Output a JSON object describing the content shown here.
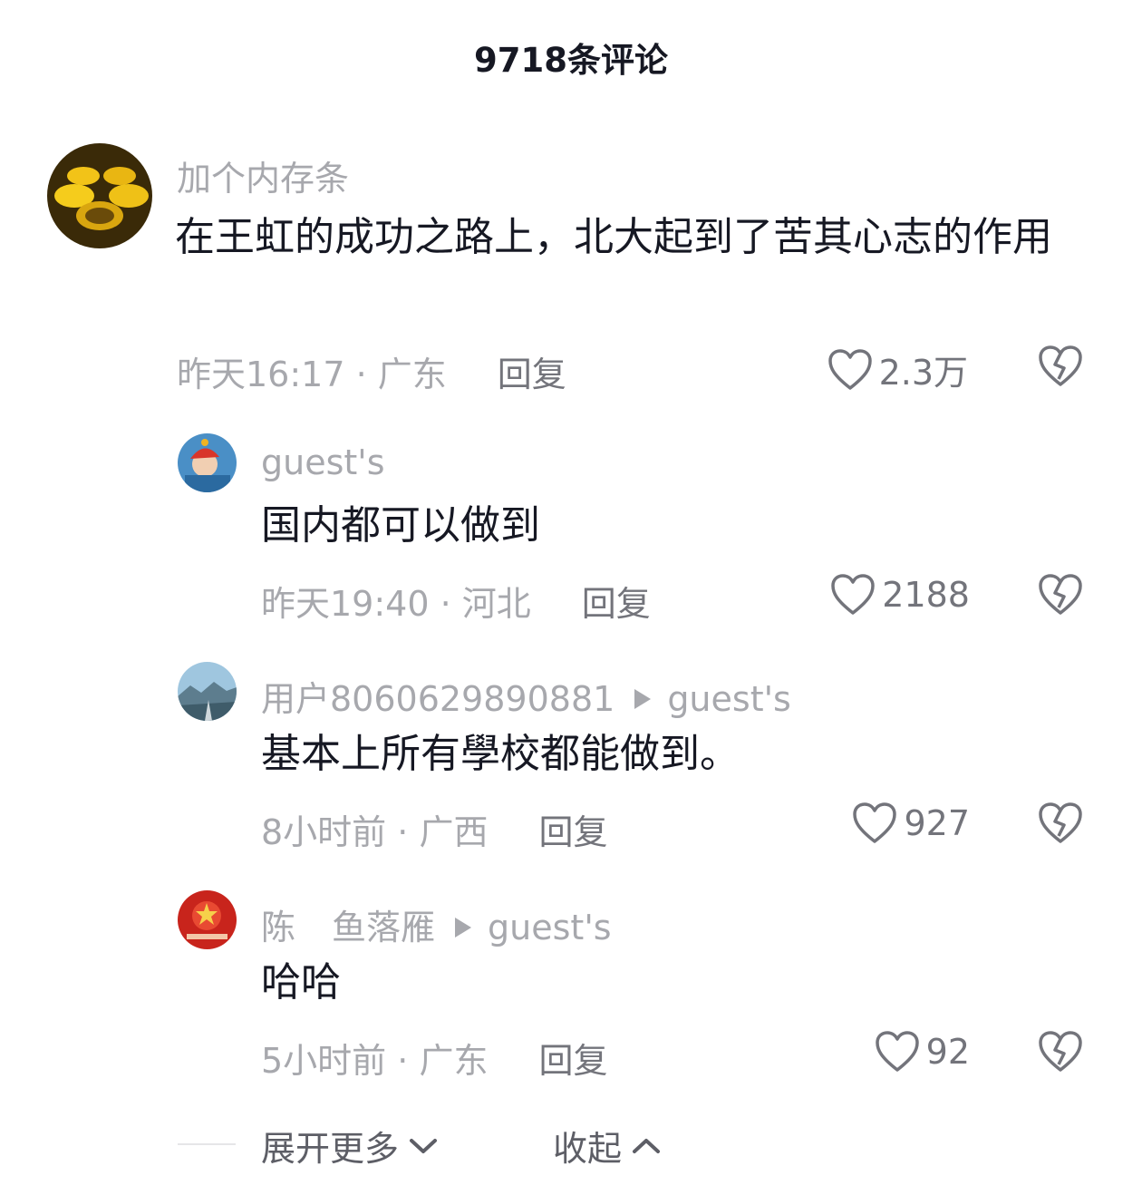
{
  "header": {
    "title": "9718条评论"
  },
  "comments": [
    {
      "username": "加个内存条",
      "content": "在王虹的成功之路上，北大起到了苦其心志的作用",
      "time": "昨天16:17",
      "location": "广东",
      "reply_label": "回复",
      "likes": "2.3万",
      "avatar_icon": "mooncake-avatar-icon"
    }
  ],
  "replies": [
    {
      "username": "guest's",
      "content": "国内都可以做到",
      "time": "昨天19:40",
      "location": "河北",
      "reply_label": "回复",
      "likes": "2188"
    },
    {
      "username": "用户8060629890881",
      "reply_to": "guest's",
      "content": "基本上所有學校都能做到。",
      "time": "8小时前",
      "location": "广西",
      "reply_label": "回复",
      "likes": "927"
    },
    {
      "username_part1": "陈",
      "username_part2": "鱼落雁",
      "reply_to": "guest's",
      "content": "哈哈",
      "time": "5小时前",
      "location": "广东",
      "reply_label": "回复",
      "likes": "92"
    }
  ],
  "separator": " · ",
  "footer": {
    "expand_more": "展开更多",
    "collapse": "收起"
  },
  "colors": {
    "text": "#161823",
    "secondary": "#a7a8ad",
    "action": "#73747b"
  }
}
